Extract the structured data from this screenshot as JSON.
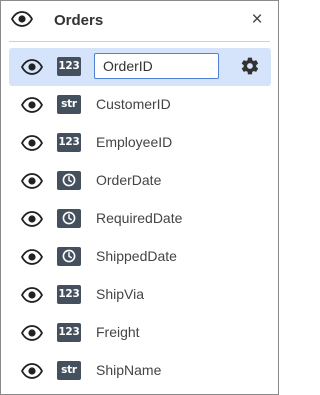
{
  "header": {
    "title": "Orders",
    "close_glyph": "×",
    "eye_icon": "eye-icon",
    "close_icon": "close-icon"
  },
  "fields": [
    {
      "type_label": "123",
      "type": "number",
      "name": "OrderID",
      "selected": true
    },
    {
      "type_label": "str",
      "type": "string",
      "name": "CustomerID"
    },
    {
      "type_label": "123",
      "type": "number",
      "name": "EmployeeID"
    },
    {
      "type_label": "",
      "type": "date",
      "name": "OrderDate"
    },
    {
      "type_label": "",
      "type": "date",
      "name": "RequiredDate"
    },
    {
      "type_label": "",
      "type": "date",
      "name": "ShippedDate"
    },
    {
      "type_label": "123",
      "type": "number",
      "name": "ShipVia"
    },
    {
      "type_label": "123",
      "type": "number",
      "name": "Freight"
    },
    {
      "type_label": "str",
      "type": "string",
      "name": "ShipName"
    }
  ],
  "colors": {
    "selected_row": "#d6e4fb",
    "badge": "#45505e",
    "field_border": "#4f80d4"
  }
}
